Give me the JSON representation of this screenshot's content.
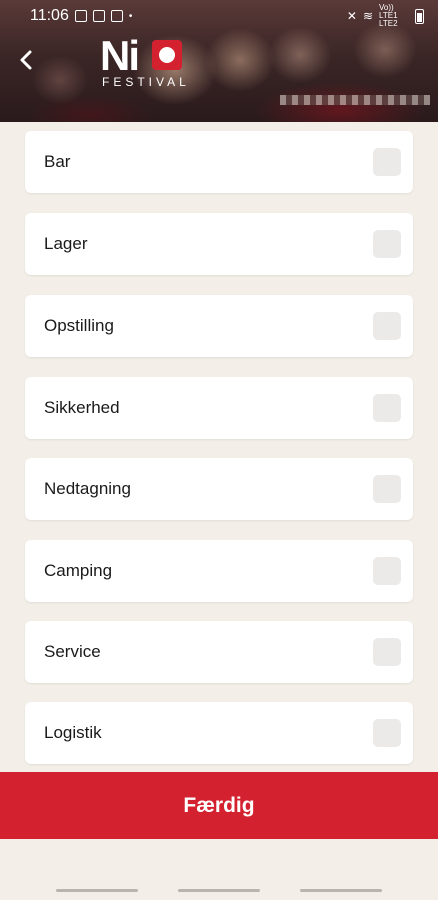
{
  "status_bar": {
    "time": "11:06",
    "network": "Vo)) LTE1 LTE2"
  },
  "header": {
    "logo_text": "Ni",
    "logo_sub": "FESTIVAL",
    "back_icon": "chevron-left-icon"
  },
  "items": [
    {
      "label": "Bar",
      "checked": false
    },
    {
      "label": "Lager",
      "checked": false
    },
    {
      "label": "Opstilling",
      "checked": false
    },
    {
      "label": "Sikkerhed",
      "checked": false
    },
    {
      "label": "Nedtagning",
      "checked": false
    },
    {
      "label": "Camping",
      "checked": false
    },
    {
      "label": "Service",
      "checked": false
    },
    {
      "label": "Logistik",
      "checked": false
    }
  ],
  "done_button": {
    "label": "Færdig"
  },
  "colors": {
    "accent": "#d4212f",
    "background": "#f3efe8",
    "card": "#ffffff",
    "checkbox": "#eceae8"
  }
}
